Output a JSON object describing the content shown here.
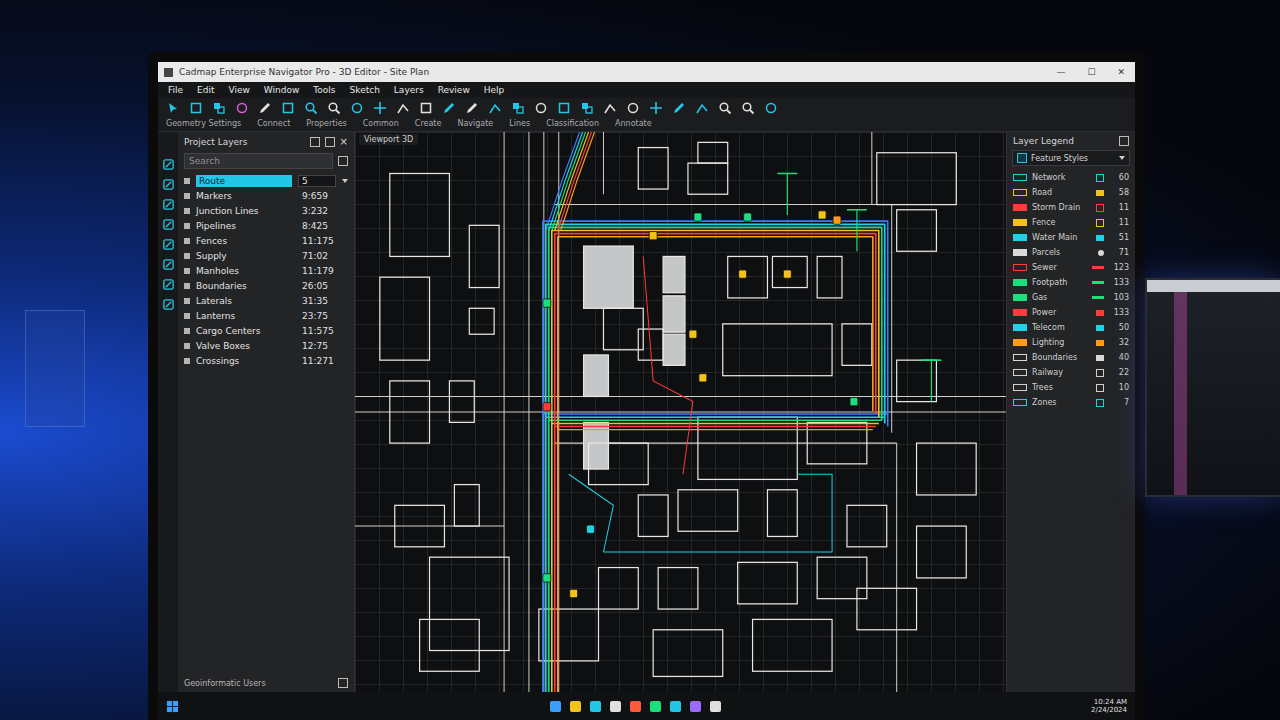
{
  "window": {
    "title": "Cadmap Enterprise Navigator Pro - 3D Editor - Site Plan",
    "controls": [
      "—",
      "☐",
      "✕"
    ]
  },
  "menu": [
    "File",
    "Edit",
    "View",
    "Window",
    "Tools",
    "Sketch",
    "Layers",
    "Review",
    "Help"
  ],
  "toolbar": {
    "groups": [
      "Geometry Settings",
      "Connect",
      "Properties",
      "Common",
      "Create",
      "Navigate",
      "Lines",
      "Classification",
      "Annotate"
    ]
  },
  "layers_panel": {
    "title": "Project Layers",
    "close": "×",
    "search_placeholder": "Search",
    "items": [
      {
        "name": "Route",
        "value": "5",
        "selected": true
      },
      {
        "name": "Markers",
        "value": "9:659",
        "selected": false
      },
      {
        "name": "Junction Lines",
        "value": "3:232",
        "selected": false
      },
      {
        "name": "Pipelines",
        "value": "8:425",
        "selected": false
      },
      {
        "name": "Fences",
        "value": "11:175",
        "selected": false
      },
      {
        "name": "Supply",
        "value": "71:02",
        "selected": false
      },
      {
        "name": "Manholes",
        "value": "11:179",
        "selected": false
      },
      {
        "name": "Boundaries",
        "value": "26:05",
        "selected": false
      },
      {
        "name": "Laterals",
        "value": "31:35",
        "selected": false
      },
      {
        "name": "Lanterns",
        "value": "23:75",
        "selected": false
      },
      {
        "name": "Cargo Centers",
        "value": "11:575",
        "selected": false
      },
      {
        "name": "Valve Boxes",
        "value": "12:75",
        "selected": false
      },
      {
        "name": "Crossings",
        "value": "11:271",
        "selected": false
      }
    ],
    "footer": "Geoinformatic Users"
  },
  "viewport": {
    "tab": "Viewport 3D"
  },
  "legend": {
    "title": "Layer Legend",
    "dropdown": "Feature Styles",
    "rows": [
      {
        "label": "Network",
        "value": "60",
        "color": "#1fd3e6",
        "outlined": true,
        "kind": "box"
      },
      {
        "label": "Road",
        "value": "58",
        "color": "#f2c318",
        "outlined": true,
        "kind": "fill"
      },
      {
        "label": "Storm Drain",
        "value": "11",
        "color": "#ff3b3b",
        "outlined": false,
        "kind": "box"
      },
      {
        "label": "Fence",
        "value": "11",
        "color": "#f2c318",
        "outlined": false,
        "kind": "box"
      },
      {
        "label": "Water Main",
        "value": "51",
        "color": "#1fd3e6",
        "outlined": false,
        "kind": "fill"
      },
      {
        "label": "Parcels",
        "value": "71",
        "color": "#d9d9d9",
        "outlined": false,
        "kind": "dot"
      },
      {
        "label": "Sewer",
        "value": "123",
        "color": "#ff3b3b",
        "outlined": true,
        "kind": "dash"
      },
      {
        "label": "Footpath",
        "value": "133",
        "color": "#19e07a",
        "outlined": false,
        "kind": "dash"
      },
      {
        "label": "Gas",
        "value": "103",
        "color": "#19e07a",
        "outlined": false,
        "kind": "dash"
      },
      {
        "label": "Power",
        "value": "133",
        "color": "#ff3b3b",
        "outlined": false,
        "kind": "fill"
      },
      {
        "label": "Telecom",
        "value": "50",
        "color": "#1fd3e6",
        "outlined": false,
        "kind": "fill"
      },
      {
        "label": "Lighting",
        "value": "32",
        "color": "#ff9a1a",
        "outlined": false,
        "kind": "fill"
      },
      {
        "label": "Boundaries",
        "value": "40",
        "color": "#d9d9d9",
        "outlined": true,
        "kind": "fill"
      },
      {
        "label": "Railway",
        "value": "22",
        "color": "#cfcfcf",
        "outlined": true,
        "kind": "box"
      },
      {
        "label": "Trees",
        "value": "10",
        "color": "#cfcfcf",
        "outlined": true,
        "kind": "box"
      },
      {
        "label": "Zones",
        "value": "7",
        "color": "#1fd3e6",
        "outlined": true,
        "kind": "box"
      }
    ]
  },
  "taskbar": {
    "time": "10:24 AM",
    "date": "2/24/2024"
  }
}
